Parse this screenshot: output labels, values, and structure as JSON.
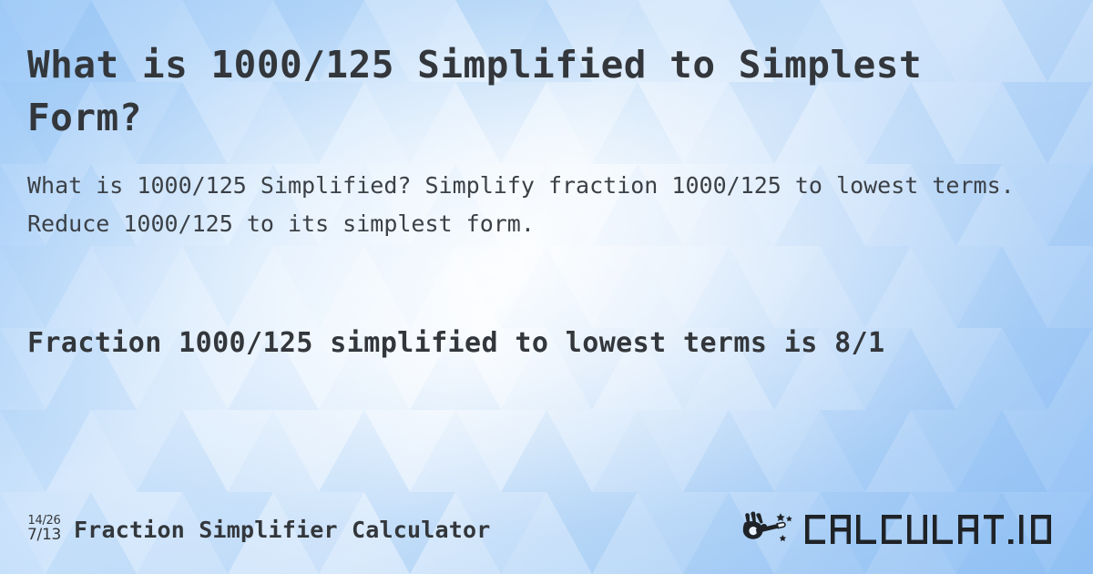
{
  "page": {
    "headline": "What is 1000/125 Simplified to Simplest Form?",
    "subhead": "What is 1000/125 Simplified? Simplify fraction 1000/125 to lowest terms. Reduce 1000/125 to its simplest form.",
    "result": "Fraction 1000/125 simplified to lowest terms is 8/1"
  },
  "answer": {
    "numerator": "8",
    "denominator": "1",
    "fraction": "8/1",
    "original": "1000/125"
  },
  "footer": {
    "icon": {
      "name": "fraction-simplify-icon",
      "top": "14/26",
      "bottom": "7/13"
    },
    "title": "Fraction Simplifier Calculator",
    "brand": {
      "name": "CALCULAT.IO",
      "wand_icon": "hand-magic-wand-icon"
    }
  },
  "colors": {
    "text_dark": "#33373b",
    "text_body": "#3b4046",
    "bg_blue_deep": "#8fc0f4",
    "bg_blue_mid": "#b4d6fa",
    "bg_blue_light": "#e9f3fd",
    "bg_white": "#ffffff"
  }
}
